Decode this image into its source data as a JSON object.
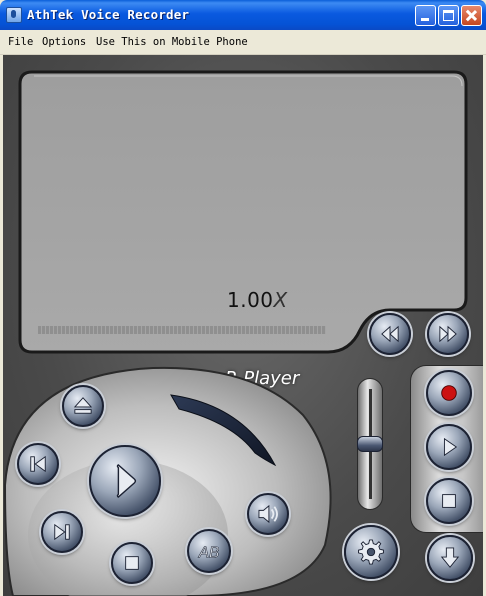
{
  "window": {
    "title": "AthTek Voice Recorder"
  },
  "menu": {
    "items": [
      "File",
      "Options",
      "Use This on Mobile Phone"
    ]
  },
  "display": {
    "speed_value": "1.00",
    "speed_unit": "X",
    "progress": 0
  },
  "brand_label": "R.Player",
  "ab_label": "AB",
  "colors": {
    "titlebar": "#0553d6",
    "body": "#4a4a4a",
    "screen": "#a6a6a6",
    "button_face": "#9aa6b8",
    "record_dot": "#cc1111"
  },
  "icons": {
    "rewind": "rewind-icon",
    "fast_forward": "fast-forward-icon",
    "record": "record-icon",
    "play": "play-icon",
    "stop": "stop-icon",
    "eject": "eject-icon",
    "previous": "previous-icon",
    "next": "next-icon",
    "volume": "speaker-icon",
    "settings": "gear-icon",
    "download": "download-icon"
  }
}
